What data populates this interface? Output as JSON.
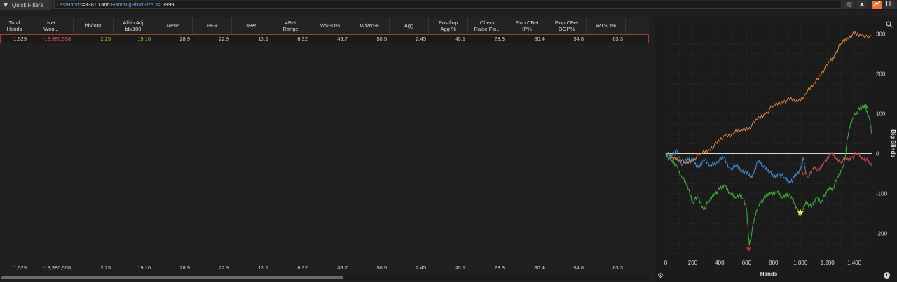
{
  "topbar": {
    "quick_filters_label": "Quick Filters",
    "filter": {
      "kw1": "LastHands",
      "v1": "=33810 and ",
      "kw2": "HandBigBlindSize",
      "op": " >= ",
      "v2": "9999"
    },
    "icons": [
      "save-icon",
      "close-icon",
      "chart-icon",
      "columns-icon"
    ]
  },
  "table": {
    "columns": [
      {
        "label": "Total\nHands",
        "w": 42
      },
      {
        "label": "Net\nWon...",
        "w": 63
      },
      {
        "label": "bb/100",
        "w": 57
      },
      {
        "label": "All-in Adj\nbb/100",
        "w": 57
      },
      {
        "label": "VPIP",
        "w": 56
      },
      {
        "label": "PFR",
        "w": 56
      },
      {
        "label": "3Bet",
        "w": 56
      },
      {
        "label": "4Bet\nRange",
        "w": 56
      },
      {
        "label": "W$SD%",
        "w": 57
      },
      {
        "label": "W$WSF",
        "w": 56
      },
      {
        "label": "Agg",
        "w": 56
      },
      {
        "label": "Postflop\nAgg %",
        "w": 56
      },
      {
        "label": "Check\nRaise Flo...",
        "w": 56
      },
      {
        "label": "Flop CBet\nIP%",
        "w": 57
      },
      {
        "label": "Flop CBet\nOOP%",
        "w": 56
      },
      {
        "label": "WTSD%",
        "w": 56
      }
    ],
    "row": [
      "1,529",
      "-18,980,558",
      "2.25",
      "19.10",
      "28.9",
      "22.9",
      "13.1",
      "6.22",
      "49.7",
      "50.5",
      "2.45",
      "40.1",
      "23.3",
      "80.4",
      "54.8",
      "63.3"
    ],
    "footer": [
      "1,529",
      "-18,980,558",
      "2.25",
      "19.10",
      "28.9",
      "22.9",
      "13.1",
      "6.22",
      "49.7",
      "50.5",
      "2.45",
      "40.1",
      "23.3",
      "80.4",
      "54.8",
      "63.3"
    ]
  },
  "chart_data": {
    "type": "line",
    "xlabel": "Hands",
    "ylabel": "Big Blinds",
    "xlim": [
      0,
      1529
    ],
    "ylim": [
      -250,
      320
    ],
    "x_ticks": [
      "0",
      "200",
      "400",
      "600",
      "800",
      "1,000",
      "1,200",
      "1,400"
    ],
    "y_ticks": [
      "300",
      "200",
      "100",
      "0",
      "-100",
      "-200"
    ],
    "y_tick_values": [
      300,
      200,
      100,
      0,
      -100,
      -200
    ],
    "x_tick_values": [
      0,
      200,
      400,
      600,
      800,
      1000,
      1200,
      1400
    ],
    "series": [
      {
        "color": "#e08a3c",
        "points": [
          [
            0,
            0
          ],
          [
            50,
            -10
          ],
          [
            100,
            -15
          ],
          [
            150,
            -25
          ],
          [
            200,
            -15
          ],
          [
            260,
            0
          ],
          [
            320,
            10
          ],
          [
            380,
            25
          ],
          [
            440,
            45
          ],
          [
            500,
            50
          ],
          [
            560,
            60
          ],
          [
            620,
            65
          ],
          [
            680,
            85
          ],
          [
            740,
            100
          ],
          [
            800,
            120
          ],
          [
            860,
            130
          ],
          [
            920,
            135
          ],
          [
            980,
            130
          ],
          [
            1040,
            150
          ],
          [
            1100,
            175
          ],
          [
            1160,
            205
          ],
          [
            1220,
            230
          ],
          [
            1260,
            250
          ],
          [
            1300,
            275
          ],
          [
            1350,
            290
          ],
          [
            1400,
            300
          ],
          [
            1450,
            295
          ],
          [
            1529,
            295
          ]
        ]
      },
      {
        "color": "#3f8ed8",
        "points": [
          [
            0,
            0
          ],
          [
            40,
            -10
          ],
          [
            80,
            10
          ],
          [
            120,
            -30
          ],
          [
            160,
            -10
          ],
          [
            200,
            -20
          ],
          [
            240,
            -35
          ],
          [
            280,
            -15
          ],
          [
            330,
            -30
          ],
          [
            380,
            -20
          ],
          [
            430,
            -10
          ],
          [
            480,
            -40
          ],
          [
            520,
            -30
          ],
          [
            560,
            -40
          ],
          [
            600,
            -50
          ],
          [
            640,
            -60
          ],
          [
            680,
            -20
          ],
          [
            720,
            -30
          ],
          [
            760,
            -40
          ],
          [
            800,
            -60
          ],
          [
            840,
            -50
          ],
          [
            880,
            -60
          ],
          [
            920,
            -70
          ],
          [
            960,
            -60
          ],
          [
            1000,
            -40
          ],
          [
            1020,
            -10
          ],
          [
            1040,
            -50
          ]
        ]
      },
      {
        "color": "#c84848",
        "points": [
          [
            1000,
            -40
          ],
          [
            1060,
            -60
          ],
          [
            1100,
            -30
          ],
          [
            1140,
            -45
          ],
          [
            1180,
            -20
          ],
          [
            1220,
            0
          ],
          [
            1260,
            -10
          ],
          [
            1300,
            -20
          ],
          [
            1340,
            -15
          ],
          [
            1380,
            -10
          ],
          [
            1420,
            0
          ],
          [
            1460,
            -10
          ],
          [
            1500,
            -20
          ],
          [
            1529,
            -30
          ]
        ]
      },
      {
        "color": "#3fae3f",
        "points": [
          [
            0,
            0
          ],
          [
            40,
            -20
          ],
          [
            80,
            -30
          ],
          [
            120,
            -60
          ],
          [
            160,
            -80
          ],
          [
            200,
            -120
          ],
          [
            240,
            -110
          ],
          [
            280,
            -140
          ],
          [
            320,
            -120
          ],
          [
            360,
            -100
          ],
          [
            400,
            -90
          ],
          [
            440,
            -80
          ],
          [
            480,
            -100
          ],
          [
            520,
            -110
          ],
          [
            560,
            -100
          ],
          [
            600,
            -140
          ],
          [
            620,
            -230
          ],
          [
            660,
            -160
          ],
          [
            700,
            -120
          ],
          [
            740,
            -110
          ],
          [
            780,
            -100
          ],
          [
            820,
            -95
          ],
          [
            860,
            -110
          ],
          [
            900,
            -100
          ],
          [
            940,
            -115
          ],
          [
            980,
            -140
          ],
          [
            1000,
            -155
          ],
          [
            1040,
            -120
          ],
          [
            1080,
            -135
          ],
          [
            1120,
            -110
          ],
          [
            1160,
            -120
          ],
          [
            1200,
            -90
          ],
          [
            1240,
            -85
          ],
          [
            1280,
            -60
          ],
          [
            1320,
            -30
          ],
          [
            1360,
            60
          ],
          [
            1400,
            100
          ],
          [
            1440,
            110
          ],
          [
            1480,
            120
          ],
          [
            1510,
            90
          ],
          [
            1529,
            50
          ]
        ]
      }
    ],
    "markers": [
      {
        "shape": "triangle-down",
        "color": "#e02020",
        "x": 615,
        "y": -240
      },
      {
        "shape": "star",
        "color": "#f2e23a",
        "x": 1000,
        "y": -148
      },
      {
        "shape": "triangle-up",
        "color": "#2f9e2f",
        "x": 1485,
        "y": 118
      }
    ]
  }
}
